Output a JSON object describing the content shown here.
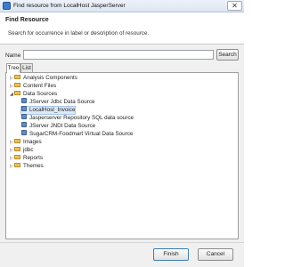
{
  "window": {
    "title": "Find resource from LocalHost JasperServer",
    "close_glyph": "✕"
  },
  "header": {
    "title": "Find Resource",
    "description": "Search for occurrence in label or description of resource."
  },
  "search": {
    "label": "Name",
    "value": "",
    "button_label": "Search"
  },
  "tabs": [
    {
      "label": "Tree"
    },
    {
      "label": "List"
    }
  ],
  "tree": {
    "items": [
      {
        "label": "Analysis Components",
        "expanded": false,
        "icon": "folder-icon"
      },
      {
        "label": "Content Files",
        "expanded": false,
        "icon": "folder-icon"
      },
      {
        "label": "Data Sources",
        "expanded": true,
        "icon": "folder-icon"
      },
      {
        "label": "JServer Jdbc Data Source",
        "icon": "datasource-icon"
      },
      {
        "label": "LocalHost_Invoice",
        "icon": "datasource-icon",
        "selected": true
      },
      {
        "label": "Jasperserver Repository SQL data source",
        "icon": "datasource-icon"
      },
      {
        "label": "JServer JNDI Data Source",
        "icon": "datasource-icon"
      },
      {
        "label": "SugarCRM-Foodmart Virtual Data Source",
        "icon": "datasource-icon"
      },
      {
        "label": "Images",
        "expanded": false,
        "icon": "folder-icon"
      },
      {
        "label": "jdbc",
        "expanded": false,
        "icon": "folder-icon"
      },
      {
        "label": "Reports",
        "expanded": false,
        "icon": "folder-icon"
      },
      {
        "label": "Themes",
        "expanded": false,
        "icon": "folder-icon"
      }
    ]
  },
  "footer": {
    "finish_label": "Finish",
    "cancel_label": "Cancel"
  }
}
